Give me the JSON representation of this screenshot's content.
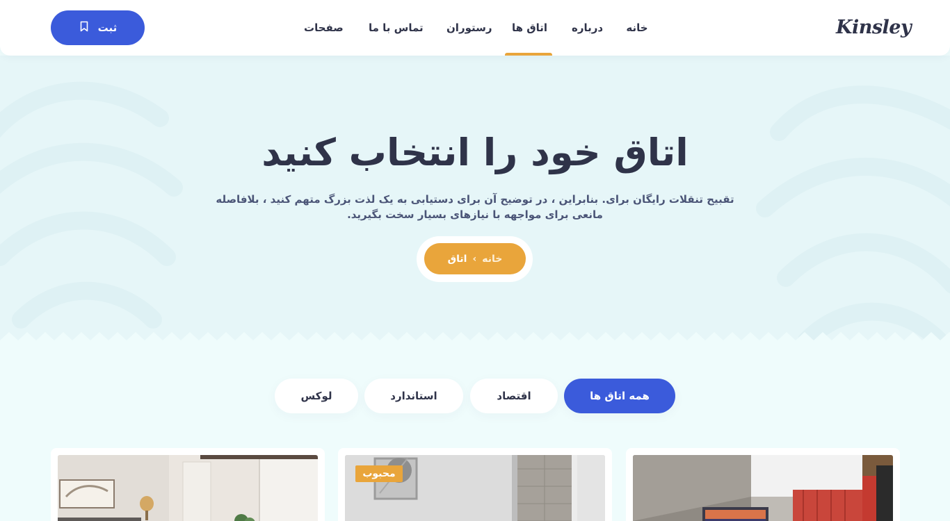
{
  "header": {
    "logo": "Kinsley",
    "nav": [
      {
        "label": "خانه"
      },
      {
        "label": "درباره"
      },
      {
        "label": "اتاق ها"
      },
      {
        "label": "رستوران"
      },
      {
        "label": "تماس با ما"
      },
      {
        "label": "صفحات"
      }
    ],
    "active_nav": "اتاق ها",
    "submit_label": "ثبت",
    "submit_icon": "bookmark-icon"
  },
  "hero": {
    "title": "اتاق خود را انتخاب کنید",
    "description": "تقبیح تنقلات رایگان برای. بنابراین ، در توضیح آن برای دستیابی به یک لذت بزرگ متهم کنید ، بلافاصله مانعی برای مواجهه با نیازهای بسیار سخت بگیرید.",
    "breadcrumb": {
      "home": "خانه",
      "separator": "›",
      "current": "اتاق"
    }
  },
  "filters": {
    "items": [
      {
        "label": "همه اتاق ها"
      },
      {
        "label": "اقتصاد"
      },
      {
        "label": "استاندارد"
      },
      {
        "label": "لوکس"
      }
    ],
    "active": "همه اتاق ها"
  },
  "cards": {
    "badge": "محبوب"
  },
  "colors": {
    "primary": "#3b5bdb",
    "accent": "#e9a53b",
    "text": "#2f3349",
    "hero_bg": "#e6f6f8",
    "page_bg": "#effcfc"
  }
}
